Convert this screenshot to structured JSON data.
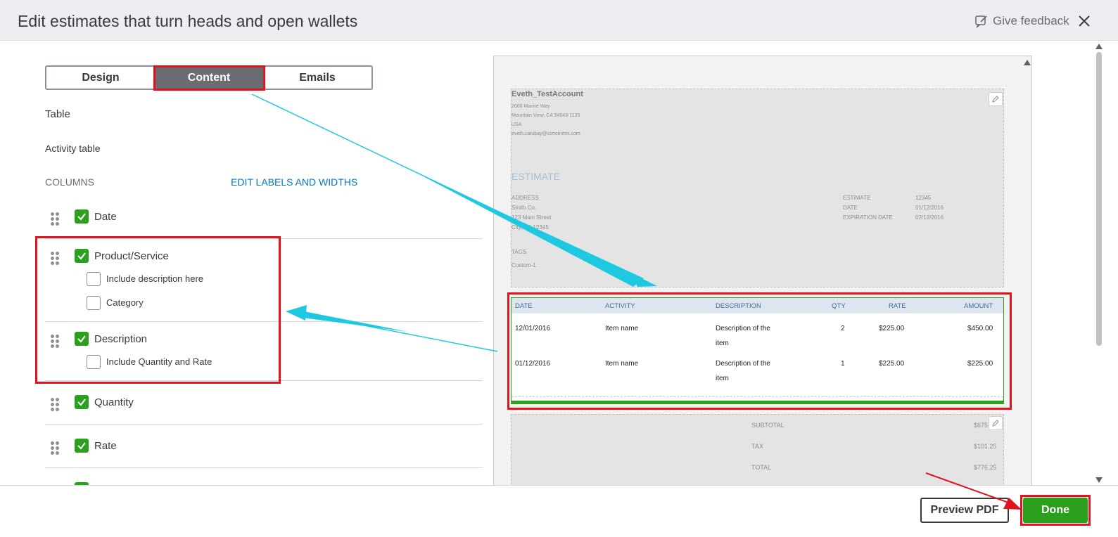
{
  "header": {
    "title": "Edit estimates that turn heads and open wallets",
    "feedback_label": "Give feedback"
  },
  "tabs": [
    {
      "label": "Design"
    },
    {
      "label": "Content"
    },
    {
      "label": "Emails"
    }
  ],
  "section": {
    "title": "Table",
    "subtitle": "Activity table",
    "columns_label": "COLUMNS",
    "edit_link": "EDIT LABELS AND WIDTHS"
  },
  "columns": [
    {
      "label": "Date",
      "checked": true
    },
    {
      "label": "Product/Service",
      "checked": true,
      "options": [
        {
          "label": "Include description here",
          "checked": false
        },
        {
          "label": "Category",
          "checked": false
        }
      ]
    },
    {
      "label": "Description",
      "checked": true,
      "options": [
        {
          "label": "Include Quantity and Rate",
          "checked": false
        }
      ]
    },
    {
      "label": "Quantity",
      "checked": true
    },
    {
      "label": "Rate",
      "checked": true
    }
  ],
  "preview": {
    "company": "Eveth_TestAccount",
    "address_lines": [
      "2600 Marine Way",
      "Mountain View, CA 94043-1126",
      "USA",
      "eveth.catubay@concentrix.com"
    ],
    "doc_title": "ESTIMATE",
    "address_label": "ADDRESS",
    "customer_lines": [
      "Smith Co.",
      "123 Main Street",
      "City, CA 12345"
    ],
    "meta": [
      {
        "label": "ESTIMATE",
        "value": "12345"
      },
      {
        "label": "DATE",
        "value": "01/12/2016"
      },
      {
        "label": "EXPIRATION DATE",
        "value": "02/12/2016"
      }
    ],
    "tags_label": "TAGS",
    "tags_value": "Custom-1",
    "table_headers": [
      "DATE",
      "ACTIVITY",
      "DESCRIPTION",
      "QTY",
      "RATE",
      "AMOUNT"
    ],
    "table_rows": [
      {
        "date": "12/01/2016",
        "activity": "Item name",
        "desc1": "Description of the",
        "desc2": "item",
        "qty": "2",
        "rate": "$225.00",
        "amount": "$450.00"
      },
      {
        "date": "01/12/2016",
        "activity": "Item name",
        "desc1": "Description of the",
        "desc2": "item",
        "qty": "1",
        "rate": "$225.00",
        "amount": "$225.00"
      }
    ],
    "totals": [
      {
        "label": "SUBTOTAL",
        "value": "$675"
      },
      {
        "label": "TAX",
        "value": "$101.25"
      },
      {
        "label": "TOTAL",
        "value": "$776.25"
      }
    ]
  },
  "footer": {
    "preview_pdf": "Preview PDF",
    "done": "Done"
  },
  "colors": {
    "accent_green": "#2ca01c",
    "annotation_red": "#e0141e",
    "annotation_cyan": "#1ec8e0",
    "link_blue": "#0077c5"
  }
}
